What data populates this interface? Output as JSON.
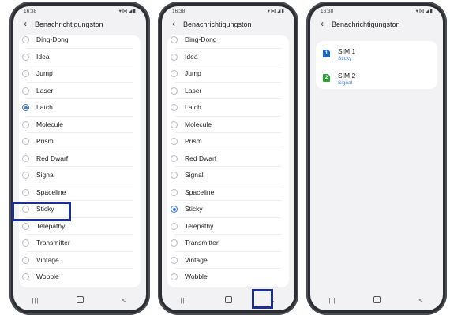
{
  "status_bar": {
    "time": "16:38",
    "icons": "▾⋈◢▮"
  },
  "nav": {
    "recents": "|||",
    "back": "<"
  },
  "colors": {
    "accent": "#3e7bd8",
    "highlight": "#1d2f92",
    "sim1": "#1b64c8",
    "sim2": "#2ea13a"
  },
  "screen1": {
    "title": "Benachrichtigungston",
    "items": [
      {
        "label": "Ding-Dong",
        "selected": false
      },
      {
        "label": "Idea",
        "selected": false
      },
      {
        "label": "Jump",
        "selected": false
      },
      {
        "label": "Laser",
        "selected": false
      },
      {
        "label": "Latch",
        "selected": true
      },
      {
        "label": "Molecule",
        "selected": false
      },
      {
        "label": "Prism",
        "selected": false
      },
      {
        "label": "Red Dwarf",
        "selected": false
      },
      {
        "label": "Signal",
        "selected": false
      },
      {
        "label": "Spaceline",
        "selected": false
      },
      {
        "label": "Sticky",
        "selected": false
      },
      {
        "label": "Telepathy",
        "selected": false
      },
      {
        "label": "Transmitter",
        "selected": false
      },
      {
        "label": "Vintage",
        "selected": false
      },
      {
        "label": "Wobble",
        "selected": false
      }
    ]
  },
  "screen2": {
    "title": "Benachrichtigungston",
    "items": [
      {
        "label": "Ding-Dong",
        "selected": false
      },
      {
        "label": "Idea",
        "selected": false
      },
      {
        "label": "Jump",
        "selected": false
      },
      {
        "label": "Laser",
        "selected": false
      },
      {
        "label": "Latch",
        "selected": false
      },
      {
        "label": "Molecule",
        "selected": false
      },
      {
        "label": "Prism",
        "selected": false
      },
      {
        "label": "Red Dwarf",
        "selected": false
      },
      {
        "label": "Signal",
        "selected": false
      },
      {
        "label": "Spaceline",
        "selected": false
      },
      {
        "label": "Sticky",
        "selected": true
      },
      {
        "label": "Telepathy",
        "selected": false
      },
      {
        "label": "Transmitter",
        "selected": false
      },
      {
        "label": "Vintage",
        "selected": false
      },
      {
        "label": "Wobble",
        "selected": false
      }
    ]
  },
  "screen3": {
    "title": "Benachrichtigungston",
    "sims": [
      {
        "icon_label": "1",
        "name": "SIM 1",
        "tone": "Sticky"
      },
      {
        "icon_label": "2",
        "name": "SIM 2",
        "tone": "Signal"
      }
    ]
  }
}
